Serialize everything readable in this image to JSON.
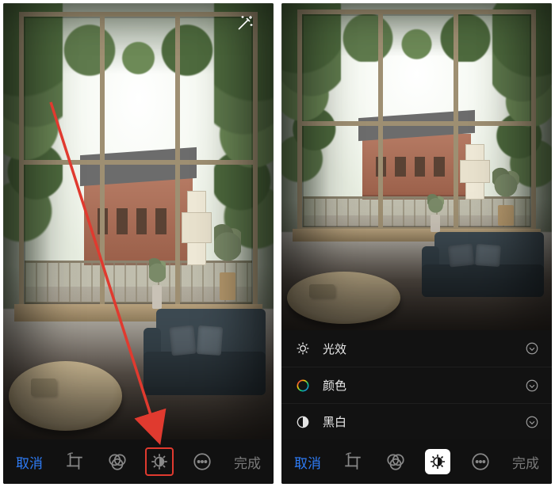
{
  "left": {
    "cancel": "取消",
    "done": "完成",
    "icons": {
      "wand": "magic-wand-icon",
      "crop": "crop-rotate-icon",
      "filters": "filters-icon",
      "adjust": "adjust-icon",
      "more": "more-icon"
    }
  },
  "right": {
    "cancel": "取消",
    "done": "完成",
    "adjustments": [
      {
        "key": "light",
        "label": "光效"
      },
      {
        "key": "color",
        "label": "颜色"
      },
      {
        "key": "bw",
        "label": "黑白"
      }
    ],
    "icons": {
      "crop": "crop-rotate-icon",
      "filters": "filters-icon",
      "adjust": "adjust-icon",
      "more": "more-icon"
    }
  },
  "colors": {
    "accent": "#2e7cf6",
    "highlight": "#e03a2f"
  }
}
